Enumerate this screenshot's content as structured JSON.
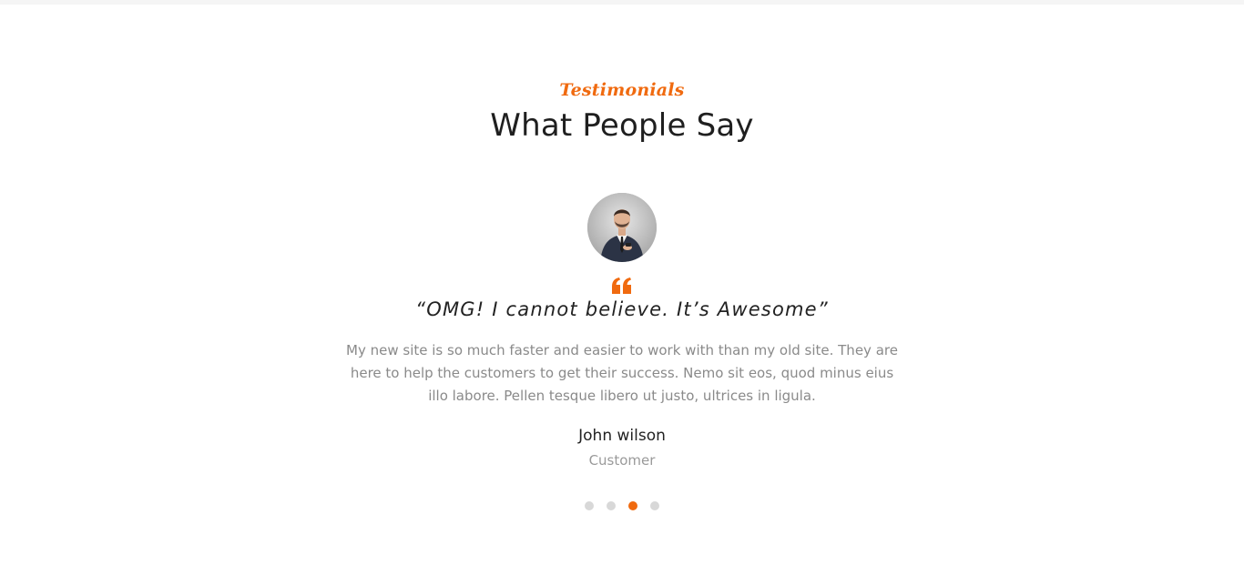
{
  "section": {
    "tag": "Testimonials",
    "title": "What People Say"
  },
  "testimonial": {
    "quote_headline": "“OMG! I cannot believe. It’s Awesome”",
    "body": "My new site is so much faster and easier to work with than my old site. They are here to help the customers to get their success. Nemo sit eos, quod minus eius illo labore. Pellen tesque libero ut justo, ultrices in ligula.",
    "author_name": "John wilson",
    "author_role": "Customer",
    "quote_icon": "quote-left-icon"
  },
  "carousel": {
    "slide_count": 4,
    "active_index": 3
  },
  "colors": {
    "accent": "#f06a0f",
    "title": "#1f1f1f",
    "body_text": "#8a8a8a",
    "dot_inactive": "#d8d8d8"
  }
}
